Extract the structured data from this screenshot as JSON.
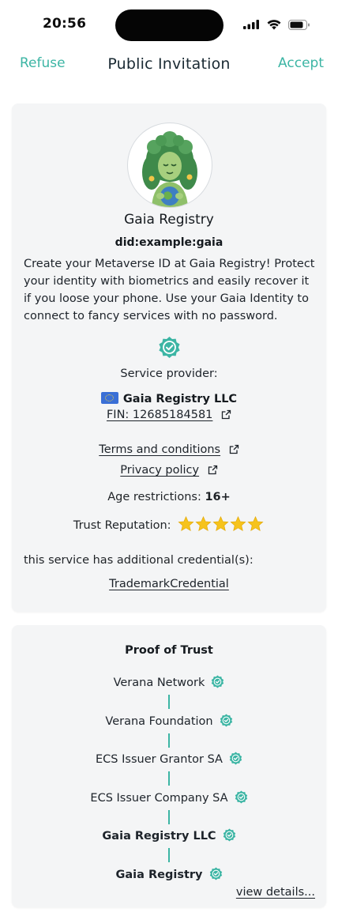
{
  "status_bar": {
    "time": "20:56"
  },
  "nav": {
    "refuse": "Refuse",
    "title": "Public Invitation",
    "accept": "Accept"
  },
  "service": {
    "name": "Gaia Registry",
    "did": "did:example:gaia",
    "description": "Create your Metaverse ID at Gaia Registry! Protect your identity with biometrics and easily recover it if you loose your phone. Use your Gaia Identity to connect to fancy services with no password.",
    "provider_label": "Service provider:",
    "provider_name": "Gaia Registry LLC",
    "fin": "FIN: 12685184581",
    "terms": "Terms and conditions",
    "privacy": "Privacy policy",
    "age_label": "Age restrictions:",
    "age_value": "16+",
    "trust_label": "Trust Reputation:",
    "trust_rating": 5,
    "trust_max": 5,
    "additional_text": "this service has additional credential(s):",
    "credential": "TrademarkCredential"
  },
  "proof_of_trust": {
    "title": "Proof of Trust",
    "chain": [
      {
        "name": "Verana Network",
        "bold": false
      },
      {
        "name": "Verana Foundation",
        "bold": false
      },
      {
        "name": "ECS Issuer Grantor SA",
        "bold": false
      },
      {
        "name": "ECS Issuer Company SA",
        "bold": false
      },
      {
        "name": "Gaia Registry LLC",
        "bold": true
      },
      {
        "name": "Gaia Registry",
        "bold": true
      }
    ],
    "view_details": "view details..."
  },
  "colors": {
    "accent": "#3cb5a4",
    "card_bg": "#f4f5f6",
    "star": "#f6c31c"
  },
  "icons": [
    "signal-icon",
    "wifi-icon",
    "battery-icon",
    "verified-badge-icon",
    "external-link-icon",
    "star-icon",
    "eu-flag-icon",
    "check-badge-icon"
  ]
}
